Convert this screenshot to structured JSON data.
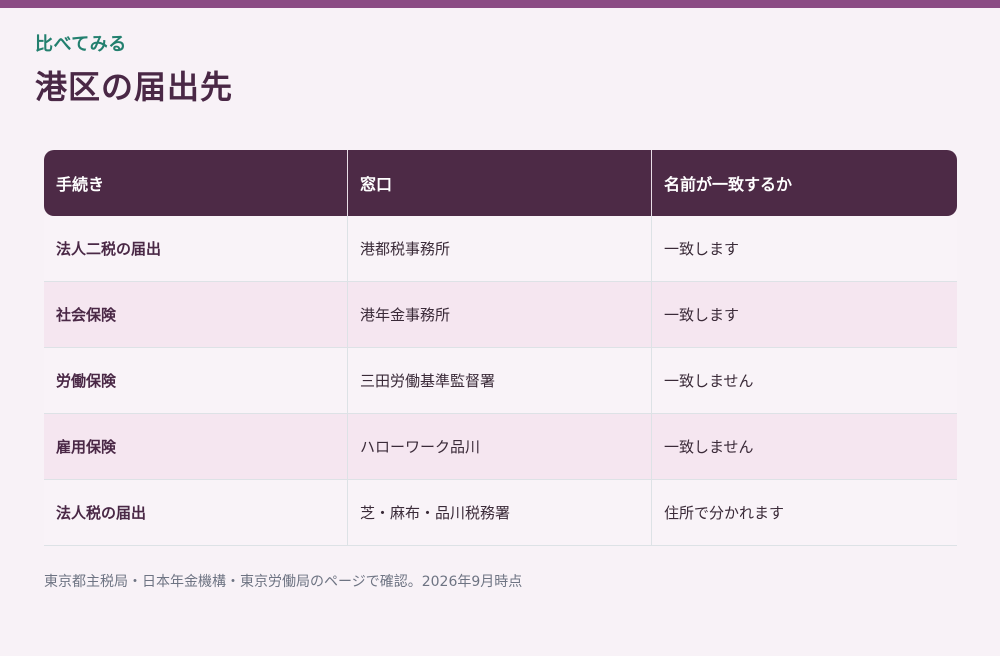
{
  "header": {
    "eyebrow": "比べてみる",
    "title": "港区の届出先"
  },
  "accent_colors": {
    "top_bar": "#8b4c84",
    "eyebrow": "#23806f",
    "table_header": "#4d2a46",
    "stripe": "#f5e6f0"
  },
  "table": {
    "columns": [
      "手続き",
      "窓口",
      "名前が一致するか"
    ],
    "rows": [
      {
        "procedure": "法人二税の届出",
        "office": "港都税事務所",
        "match": "一致します"
      },
      {
        "procedure": "社会保険",
        "office": "港年金事務所",
        "match": "一致します"
      },
      {
        "procedure": "労働保険",
        "office": "三田労働基準監督署",
        "match": "一致しません"
      },
      {
        "procedure": "雇用保険",
        "office": "ハローワーク品川",
        "match": "一致しません"
      },
      {
        "procedure": "法人税の届出",
        "office": "芝・麻布・品川税務署",
        "match": "住所で分かれます"
      }
    ]
  },
  "footnote": "東京都主税局・日本年金機構・東京労働局のページで確認。2026年9月時点"
}
